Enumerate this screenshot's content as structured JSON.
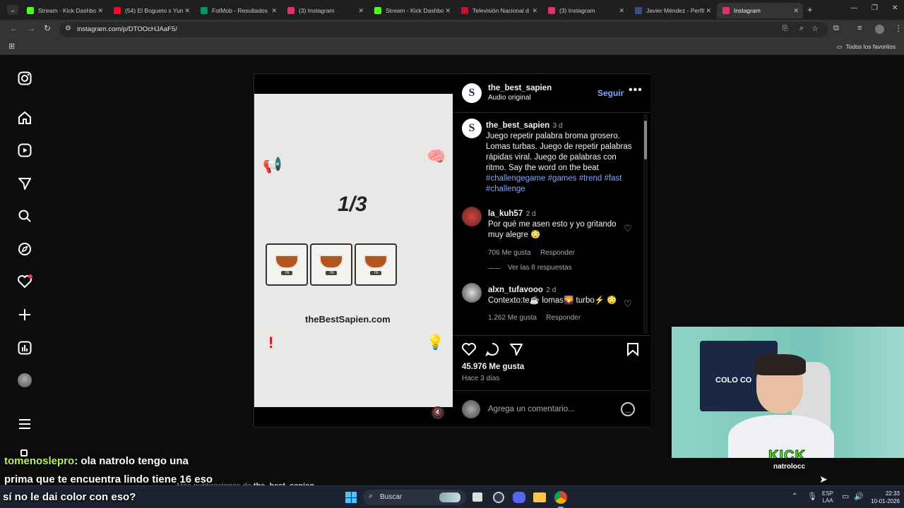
{
  "browser": {
    "tabs": [
      {
        "title": "Stream - Kick Dashbo",
        "color": "#53fc18"
      },
      {
        "title": "(54) El Bogueto x Yun",
        "color": "#ff0033"
      },
      {
        "title": "FotMob - Resultados",
        "color": "#00985f"
      },
      {
        "title": "(3) Instagram",
        "color": "#e1306c"
      },
      {
        "title": "Stream - Kick Dashbo",
        "color": "#53fc18"
      },
      {
        "title": "Televisión Nacional d",
        "color": "#c8102e"
      },
      {
        "title": "(3) Instagram",
        "color": "#e1306c"
      },
      {
        "title": "Javier Méndez - Perfil",
        "color": "#3b4a8c"
      },
      {
        "title": "Instagram",
        "color": "#e1306c"
      }
    ],
    "url": "instagram.com/p/DTOOcHJAaF5/",
    "favorites_label": "Todos los favoritos"
  },
  "post": {
    "author": "the_best_sapien",
    "audio": "Audio original",
    "follow": "Seguir",
    "caption_user": "the_best_sapien",
    "caption_time": "3 d",
    "caption_text": "Juego repetir palabra broma grosero. Lomas turbas. Juego de repetir palabras rápidas viral. Juego de palabras con ritmo. Say the word on the beat",
    "hashtags_line1": "#challengegame #games #trend #fast",
    "hashtags_line2": "#challenge",
    "comments": [
      {
        "user": "la_kuh57",
        "time": "2 d",
        "text": "Por qué me asen esto y yo gritando muy alegre 😳",
        "likes": "706 Me gusta",
        "reply": "Responder",
        "view_replies": "Ver las 8 respuestas"
      },
      {
        "user": "alxn_tufavooo",
        "time": "2 d",
        "text": "Contexto:te☕ lomas🌄 turbo⚡ 😳",
        "likes": "1.262 Me gusta",
        "reply": "Responder"
      }
    ],
    "likes_count": "45.976 Me gusta",
    "posted": "Hace 3 días",
    "comment_placeholder": "Agrega un comentario...",
    "more_posts_prefix": "Más publicaciones de",
    "more_posts_user": "the_best_sapien"
  },
  "video": {
    "counter": "1/3",
    "site": "theBestSapien.com",
    "tile_label": "T6"
  },
  "chat": {
    "user": "tomenoslepro",
    "line1": ": ola natrolo tengo una",
    "line2": "prima que te encuentra lindo tiene 16 eso",
    "line3": "sí no le dai color con eso?"
  },
  "webcam": {
    "logo_main": "KICK",
    "logo_sub": "natrolocc",
    "banner": "COLO CO"
  },
  "taskbar": {
    "search": "Buscar",
    "lang1": "ESP",
    "lang2": "LAA",
    "time": "22:33",
    "date": "10-01-2026"
  }
}
